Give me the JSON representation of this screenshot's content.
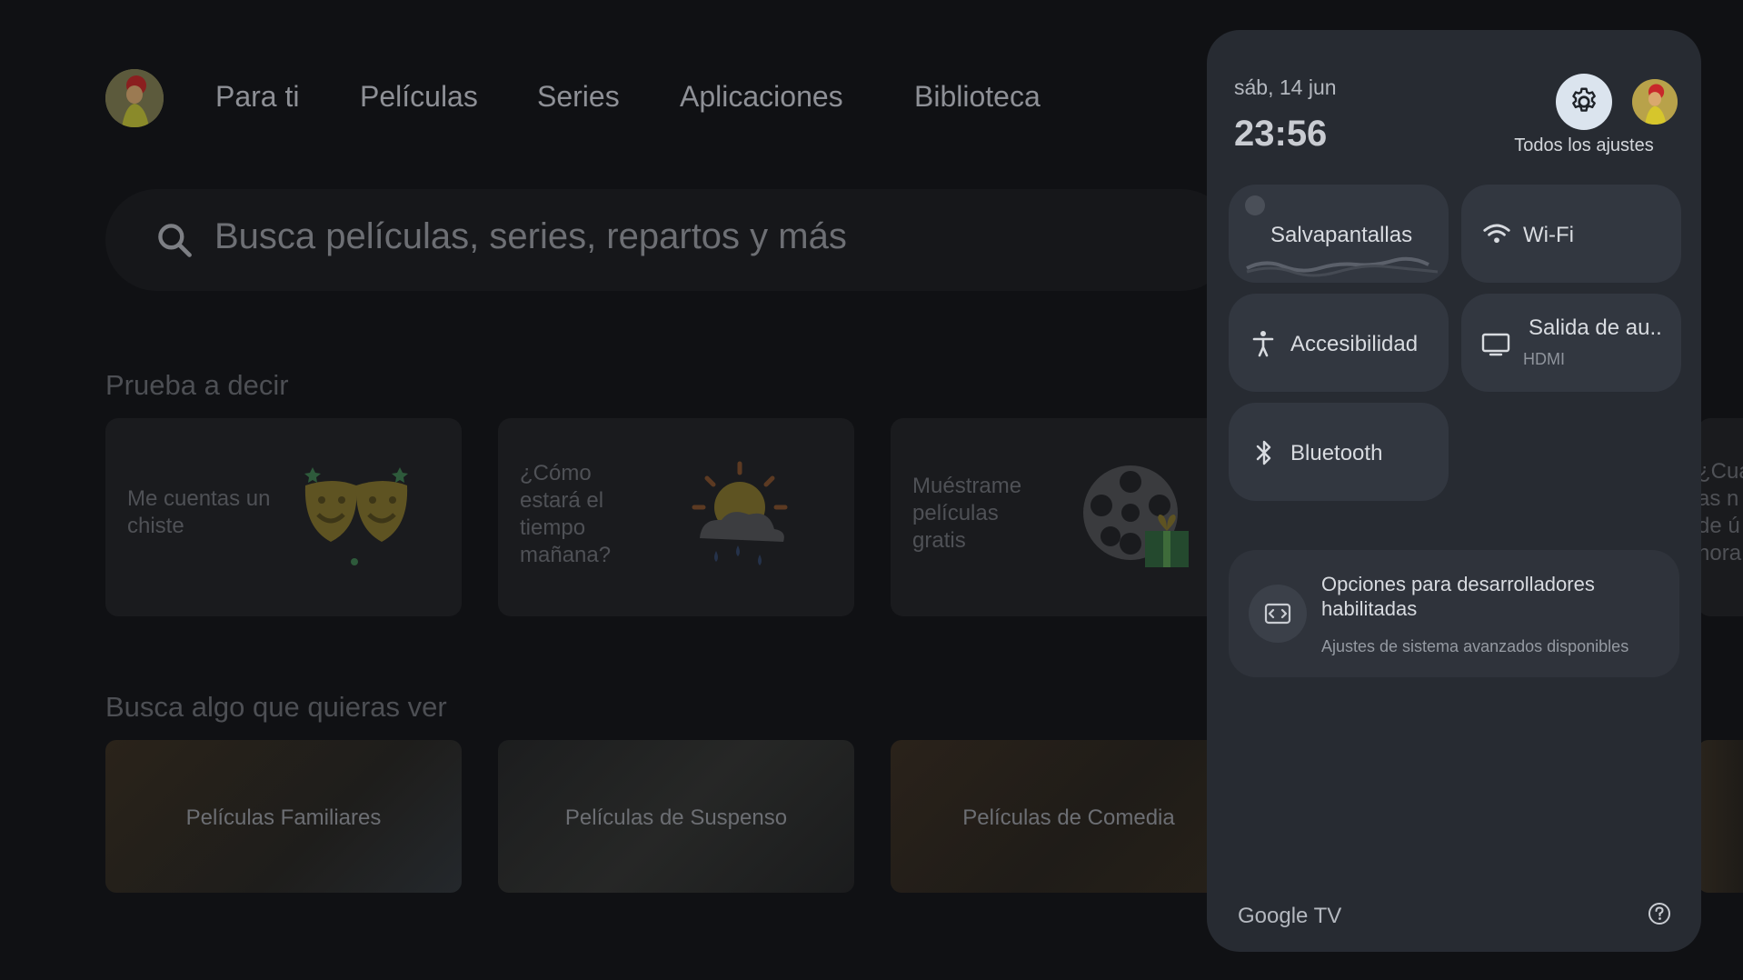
{
  "home": {
    "nav": [
      {
        "label": "Para ti"
      },
      {
        "label": "Películas"
      },
      {
        "label": "Series"
      },
      {
        "label": "Aplicaciones"
      },
      {
        "label": "Biblioteca"
      }
    ],
    "search_placeholder": "Busca películas, series, repartos y más",
    "try_saying_title": "Prueba a decir",
    "suggestions": [
      {
        "text": "Me cuentas un chiste",
        "icon": "theater-masks-icon"
      },
      {
        "text": "¿Cómo estará el tiempo mañana?",
        "icon": "weather-sun-cloud-icon"
      },
      {
        "text": "Muéstrame películas gratis",
        "icon": "film-reel-gift-icon"
      }
    ],
    "suggestion_edge_text": "¿Cuá\nas n\nde ú\nhora",
    "browse_title": "Busca algo que quieras ver",
    "genres": [
      {
        "label": "Películas Familiares"
      },
      {
        "label": "Películas de Suspenso"
      },
      {
        "label": "Películas de Comedia"
      }
    ]
  },
  "panel": {
    "date": "sáb, 14 jun",
    "time": "23:56",
    "all_settings_label": "Todos los ajustes",
    "tiles": {
      "screensaver": {
        "label": "Salvapantallas"
      },
      "wifi": {
        "label": "Wi-Fi"
      },
      "accessibility": {
        "label": "Accesibilidad"
      },
      "audio_output": {
        "label": "Salida de au..",
        "sub": "HDMI"
      },
      "bluetooth": {
        "label": "Bluetooth"
      }
    },
    "developer": {
      "title": "Opciones para desarrolladores habilitadas",
      "subtitle": "Ajustes de sistema avanzados disponibles"
    },
    "brand": "Google TV"
  },
  "colors": {
    "panel_bg": "#272b32",
    "tile_bg": "#323740",
    "settings_button_bg": "#dbe4ee"
  }
}
